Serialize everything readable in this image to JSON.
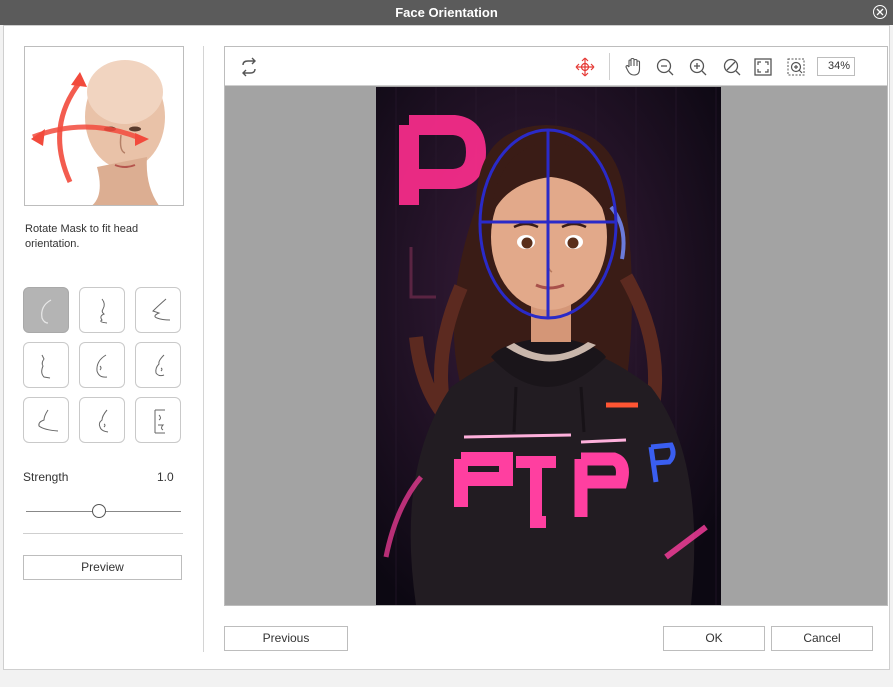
{
  "window": {
    "title": "Face Orientation"
  },
  "left_panel": {
    "description": "Rotate Mask to fit head orientation.",
    "presets": [
      {
        "name": "front",
        "active": true
      },
      {
        "name": "left-profile-up",
        "active": false
      },
      {
        "name": "right-profile-up",
        "active": false
      },
      {
        "name": "left-profile",
        "active": false
      },
      {
        "name": "three-quarter-left",
        "active": false
      },
      {
        "name": "three-quarter-right",
        "active": false
      },
      {
        "name": "left-profile-down",
        "active": false
      },
      {
        "name": "three-quarter-down",
        "active": false
      },
      {
        "name": "right-profile",
        "active": false
      }
    ],
    "strength": {
      "label": "Strength",
      "value": "1.0"
    },
    "preview_label": "Preview"
  },
  "toolbar": {
    "icons": [
      "reset-rotation-icon",
      "move-mask-icon",
      "pan-hand-icon",
      "zoom-out-icon",
      "zoom-in-icon",
      "actual-size-icon",
      "fit-window-icon",
      "zoom-selection-icon"
    ],
    "zoom": "34%"
  },
  "footer": {
    "previous_label": "Previous",
    "ok_label": "OK",
    "cancel_label": "Cancel"
  },
  "colors": {
    "titlebar": "#5b5b5b",
    "accent": "#e53935",
    "canvas_bg": "#a3a3a3",
    "mask": "#2a2ac8"
  }
}
